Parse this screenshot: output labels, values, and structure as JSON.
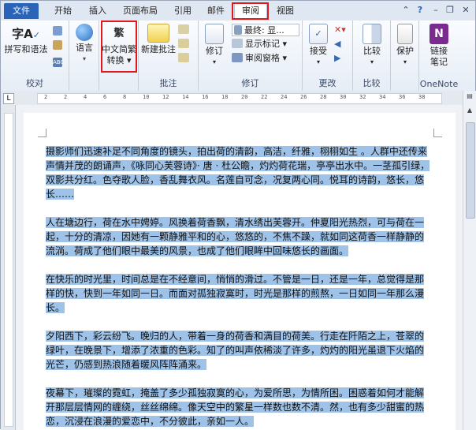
{
  "tabs": {
    "file": "文件",
    "home": "开始",
    "insert": "插入",
    "layout": "页面布局",
    "references": "引用",
    "mailings": "邮件",
    "review": "审阅",
    "view": "视图"
  },
  "ribbon": {
    "proofing": {
      "label": "校对",
      "spelling": "拼写和语法"
    },
    "language": {
      "label": "语言"
    },
    "chinese_convert": {
      "label_line1": "中文简繁",
      "label_line2": "转换"
    },
    "comments": {
      "label": "批注",
      "new_comment": "新建批注"
    },
    "tracking": {
      "label": "修订",
      "track_changes": "修订",
      "final_display": "最终: 显...",
      "show_markup": "显示标记",
      "review_pane": "审阅窗格"
    },
    "changes": {
      "label": "更改",
      "accept": "接受"
    },
    "compare": {
      "label": "比较",
      "compare": "比较"
    },
    "protect": {
      "protect": "保护"
    },
    "onenote": {
      "label": "OneNote",
      "linked_notes_line1": "链接",
      "linked_notes_line2": "笔记"
    }
  },
  "ruler": {
    "ticks": [
      "2",
      "2",
      "4",
      "6",
      "8",
      "10",
      "12",
      "14",
      "16",
      "18",
      "20",
      "22",
      "24",
      "26",
      "28",
      "30",
      "32",
      "34",
      "36",
      "38"
    ]
  },
  "document": {
    "paragraphs": [
      "摄影师们迅速补足不同角度的镜头，拍出荷的清韵，高洁，纤雅，栩栩如生 。人群中还传来声情并茂的朗诵声，《咏同心芙蓉诗》· 唐 · 杜公瞻，灼灼荷花瑞，亭亭出水中。一茎孤引绿，双影共分红。色夺歌人脸，香乱舞衣风。名莲自可念，况复两心同。悦耳的诗韵，悠长，悠长……",
      "人在塘边行，荷在水中娉婷。风换着荷香飘，清水绣出芙蓉开。仲夏阳光热烈，可与荷在一起，十分的清凉，因她有一颗静雅平和的心，悠悠的，不焦不躁，就如同这荷香一样静静的流淌。荷成了他们眼中最美的风景，也成了他们眼眸中回味悠长的画面。",
      "在快乐的时光里，时间总是在不经意间，悄悄的滑过。不管是一日，还是一年，总觉得是那样的快，快到一年如同一日。而面对孤独寂寞时，时光是那样的煎熬，一日如同一年那么漫长。",
      "夕阳西下，彩云纷飞。晚归的人，带着一身的荷香和满目的荷美。行走在阡陌之上，苍翠的绿叶，在晚景下，增添了浓重的色彩。知了的叫声依稀淡了许多，灼灼的阳光虽退下火焰的光芒，仍感到热浪随着暖风阵阵涌来。",
      "夜幕下，璀璨的霓虹，掩盖了多少孤独寂寞的心，为爱所思，为情所困。困惑着如何才能解开那层层情网的缠绕，丝丝绵绵。像天空中的繁星一样数也数不清。然，也有多少甜蜜的热恋，沉浸在浪漫的爱恋中，不分彼此，亲如一人。"
    ]
  },
  "colors": {
    "highlight": "#9ec2e8",
    "file_tab": "#2a64b8",
    "red_box": "#e0171b"
  }
}
